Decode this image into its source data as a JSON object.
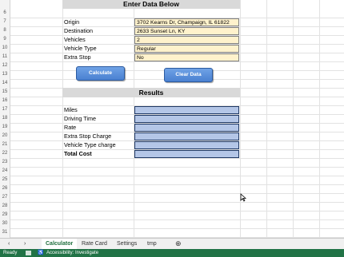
{
  "rows": [
    "6",
    "7",
    "8",
    "9",
    "10",
    "11",
    "12",
    "13",
    "14",
    "15",
    "16",
    "17",
    "18",
    "19",
    "20",
    "21",
    "22",
    "23",
    "24",
    "25",
    "26",
    "27",
    "28",
    "29",
    "30",
    "31",
    "32"
  ],
  "top_row_partial": "5",
  "enter_header": "Enter Data Below",
  "results_header": "Results",
  "inputs": [
    {
      "label": "Origin",
      "value": "3702 Kearns Dr, Champaign, IL 61822"
    },
    {
      "label": "Destination",
      "value": "2633 Sunset Ln, KY"
    },
    {
      "label": "Vehicles",
      "value": "2"
    },
    {
      "label": "Vehicle Type",
      "value": "Regular"
    },
    {
      "label": "Extra Stop",
      "value": "No"
    }
  ],
  "buttons": {
    "calculate": "Calculate",
    "clear": "Clear Data"
  },
  "results": [
    "Miles",
    "Driving Time",
    "Rate",
    "Extra Stop Charge",
    "Vehicle Type charge",
    "Total Cost"
  ],
  "tabs": {
    "nav_prev": "‹",
    "nav_next": "›",
    "items": [
      "Calculator",
      "Rate Card",
      "Settings",
      "tmp"
    ],
    "add": "⊕"
  },
  "status": {
    "ready": "Ready",
    "accessibility": "Accessibility: Investigate"
  }
}
